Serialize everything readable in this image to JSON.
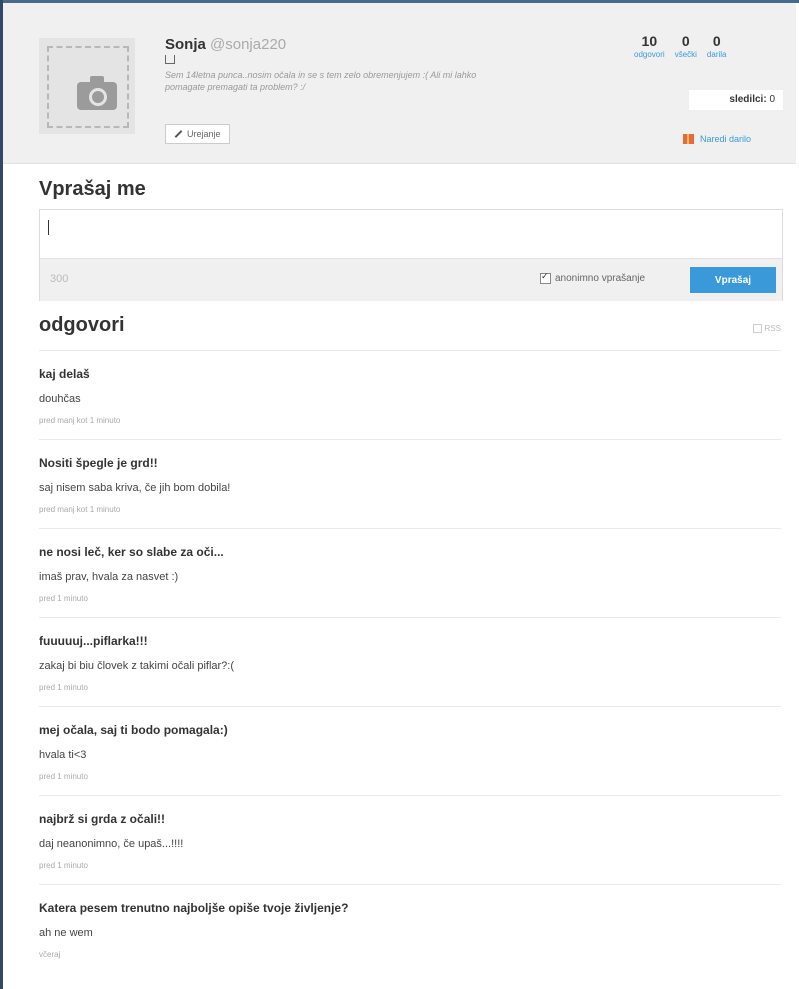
{
  "profile": {
    "name": "Sonja",
    "handle": "@sonja220",
    "bio": "Sem 14letna punca..nosim očala in se s tem zelo obremenjujem :( Ali mi lahko pomagate premagati ta problem? :/",
    "edit_label": "Urejanje",
    "stats": [
      {
        "value": "10",
        "label": "odgovori"
      },
      {
        "value": "0",
        "label": "všečki"
      },
      {
        "value": "0",
        "label": "darila"
      }
    ],
    "followers_label": "sledilci:",
    "followers_count": "0",
    "gift_label": "Naredi darilo"
  },
  "ask": {
    "title": "Vprašaj me",
    "char_count": "300",
    "anon_label": "anonimno vprašanje",
    "button_label": "Vprašaj"
  },
  "answers": {
    "title": "odgovori",
    "rss_label": "RSS",
    "items": [
      {
        "question": "kaj delaš",
        "answer": "douhčas",
        "time": "pred manj kot 1 minuto"
      },
      {
        "question": "Nositi špegle je grd!!",
        "answer": "saj nisem saba kriva, če jih bom dobila!",
        "time": "pred manj kot 1 minuto"
      },
      {
        "question": "ne nosi leč, ker so slabe za oči...",
        "answer": "imaš prav, hvala za nasvet :)",
        "time": "pred 1 minuto"
      },
      {
        "question": "fuuuuuj...piflarka!!!",
        "answer": "zakaj bi biu človek z takimi očali piflar?:(",
        "time": "pred 1 minuto"
      },
      {
        "question": "mej očala, saj ti bodo pomagala:)",
        "answer": "hvala ti<3",
        "time": "pred 1 minuto"
      },
      {
        "question": "najbrž si grda z očali!!",
        "answer": "daj neanonimno, če upaš...!!!!",
        "time": "pred 1 minuto"
      },
      {
        "question": "Katera pesem trenutno najboljše opiše tvoje življenje?",
        "answer": "ah ne wem",
        "time": "včeraj"
      }
    ]
  }
}
